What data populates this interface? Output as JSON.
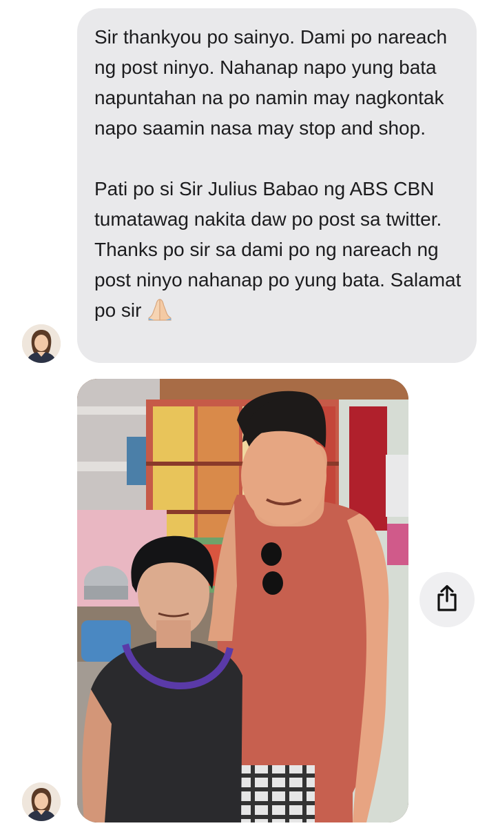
{
  "message": {
    "paragraph_1": "Sir thankyou po sainyo. Dami po nareach ng post ninyo. Nahanap napo yung bata napuntahan na po namin may nagkontak napo saamin nasa may stop and shop.",
    "paragraph_2_before_emoji": "Pati po si Sir Julius Babao ng ABS CBN tumatawag nakita daw po post sa twitter. Thanks po sir sa dami po ng nareach ng post ninyo nahanap po yung bata. Salamat po sir ",
    "emoji": "praying-hands-icon"
  },
  "attachment": {
    "type": "photo"
  },
  "actions": {
    "share_icon": "share-icon"
  },
  "colors": {
    "bubble_background": "#e9e9eb",
    "text": "#1c1c1e",
    "share_button_background": "#efeff1"
  }
}
